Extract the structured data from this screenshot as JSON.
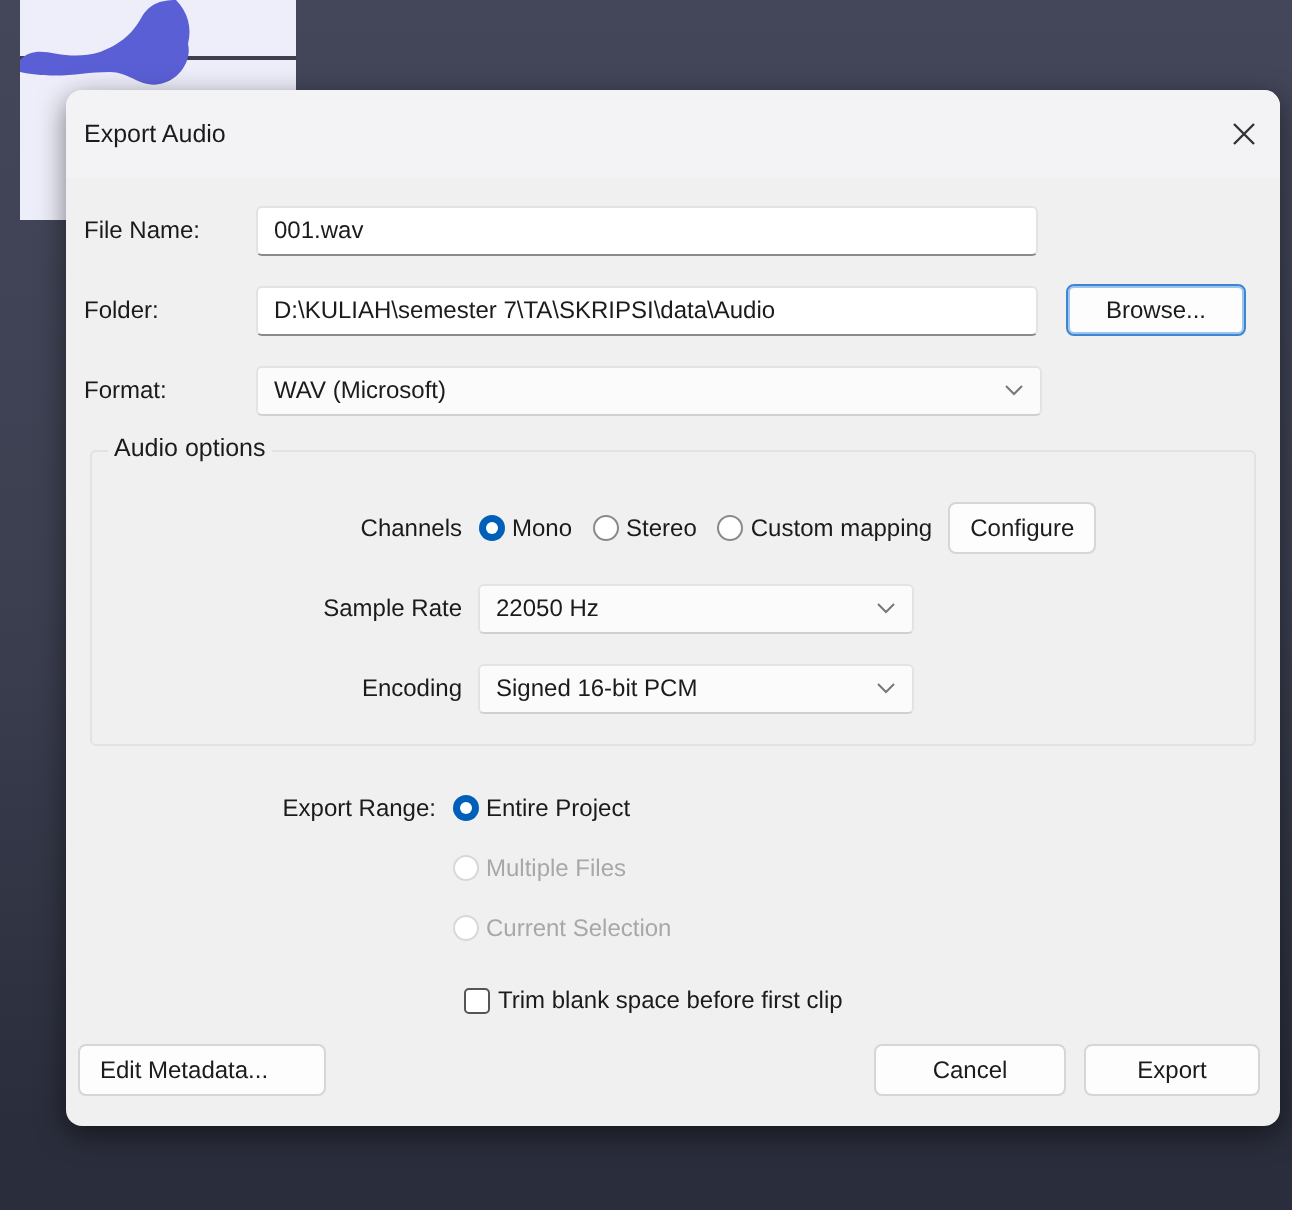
{
  "window": {
    "title": "Export Audio"
  },
  "file_name": {
    "label": "File Name:",
    "value": "001.wav"
  },
  "folder": {
    "label": "Folder:",
    "value": "D:\\KULIAH\\semester 7\\TA\\SKRIPSI\\data\\Audio",
    "browse_button": "Browse..."
  },
  "format": {
    "label": "Format:",
    "value": "WAV (Microsoft)"
  },
  "audio_options": {
    "title": "Audio options",
    "channels": {
      "label": "Channels",
      "options": [
        {
          "label": "Mono",
          "selected": true
        },
        {
          "label": "Stereo",
          "selected": false
        },
        {
          "label": "Custom mapping",
          "selected": false
        }
      ]
    },
    "configure_button": "Configure",
    "sample_rate": {
      "label": "Sample Rate",
      "value": "22050 Hz"
    },
    "encoding": {
      "label": "Encoding",
      "value": "Signed 16-bit PCM"
    }
  },
  "export_range": {
    "label": "Export Range:",
    "options": [
      {
        "label": "Entire Project",
        "selected": true,
        "disabled": false
      },
      {
        "label": "Multiple Files",
        "selected": false,
        "disabled": true
      },
      {
        "label": "Current Selection",
        "selected": false,
        "disabled": true
      }
    ]
  },
  "trim_checkbox": {
    "label": "Trim blank space before first clip",
    "checked": false
  },
  "buttons": {
    "edit_metadata": "Edit Metadata...",
    "cancel": "Cancel",
    "export": "Export"
  }
}
